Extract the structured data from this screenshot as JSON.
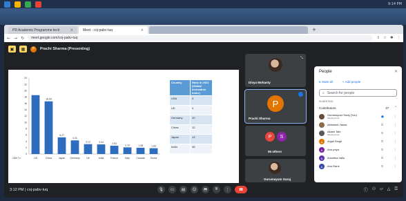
{
  "os": {
    "clock": "9:14 PM"
  },
  "browser": {
    "tabs": [
      {
        "label": "PR Academic Programme tech"
      },
      {
        "label": "Meet - coj-pabv-tuq"
      },
      {
        "label": ""
      }
    ],
    "url": "meet.google.com/coj-pabv-tuq",
    "new_tab": "+"
  },
  "presenting": {
    "avatar_letter": "P",
    "label": "Prachi Sharma (Presenting)"
  },
  "chart_data": {
    "type": "bar",
    "categories": [
      "US",
      "China",
      "Japan",
      "Germany",
      "UK",
      "India",
      "France",
      "Italy",
      "Canada",
      "Korea"
    ],
    "values": [
      18.6,
      16.64,
      5.27,
      4.31,
      3.12,
      3.04,
      2.63,
      2.1,
      1.98,
      1.83
    ],
    "value_labels": [
      "",
      "16.64",
      "5.27",
      "4.31",
      "3.12",
      "3.04",
      "2.63",
      "2.10",
      "1.98",
      "1.83"
    ],
    "y_ticks": [
      "24",
      "22",
      "20",
      "18",
      "16",
      "14",
      "12",
      "10",
      "8",
      "6",
      "4",
      "2",
      "0"
    ],
    "ylim": [
      0,
      24
    ],
    "x_prefix": "1000 Tn",
    "colors": {
      "bar": "#2e6cc0"
    }
  },
  "gii_table": {
    "headers": [
      "Country",
      "Rank in 2021 (Global Innovation Index)"
    ],
    "rows": [
      [
        "USA",
        "3"
      ],
      [
        "UK",
        "4"
      ],
      [
        "Germany",
        "10"
      ],
      [
        "China",
        "12"
      ],
      [
        "Japan",
        "13"
      ],
      [
        "India",
        "46"
      ]
    ]
  },
  "tiles": {
    "divya": {
      "name": "Divya Mohanty"
    },
    "prachi": {
      "name": "Prachi Sharma",
      "letter": "P"
    },
    "others": {
      "label": "55 others",
      "letter_p": "P",
      "letter_s": "S"
    },
    "guru": {
      "name": "Gurumayum Suraj"
    }
  },
  "bottom": {
    "meeting_info": "3:12 PM | coj-pabv-tuq"
  },
  "people": {
    "title": "People",
    "mute_all": "Mute all",
    "add_people": "Add people",
    "search_placeholder": "Search for people",
    "section_label": "IN MEETING",
    "contributors_label": "Contributors",
    "contributors_count": "47",
    "list": [
      {
        "name": "Gurumayum Suraj (You)",
        "sub": "Meeting host",
        "letter": "",
        "color": "#6b4a3a"
      },
      {
        "name": "Abhishek Yadav",
        "sub": "",
        "letter": "",
        "color": "#8a6a4a"
      },
      {
        "name": "Akash Tale",
        "sub": "Meeting host",
        "letter": "",
        "color": "#5a5a5a"
      },
      {
        "name": "Anjali Singh",
        "sub": "",
        "letter": "A",
        "color": "#e37400"
      },
      {
        "name": "Anu priya",
        "sub": "",
        "letter": "A",
        "color": "#7b1fa2"
      },
      {
        "name": "Anushka Valis",
        "sub": "",
        "letter": "A",
        "color": "#5e35b1"
      },
      {
        "name": "Anu Rane",
        "sub": "",
        "letter": "A",
        "color": "#3949ab"
      }
    ]
  }
}
